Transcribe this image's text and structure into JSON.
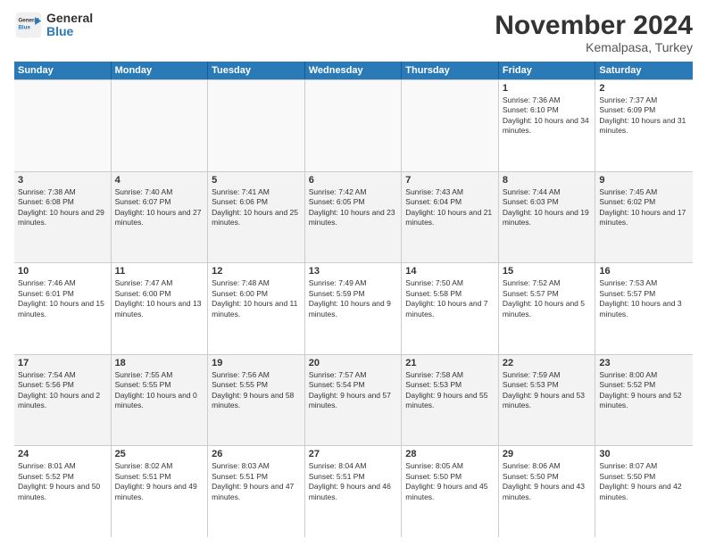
{
  "logo": {
    "general": "General",
    "blue": "Blue"
  },
  "title": "November 2024",
  "location": "Kemalpasa, Turkey",
  "days_header": [
    "Sunday",
    "Monday",
    "Tuesday",
    "Wednesday",
    "Thursday",
    "Friday",
    "Saturday"
  ],
  "rows": [
    [
      {
        "day": "",
        "info": "",
        "empty": true
      },
      {
        "day": "",
        "info": "",
        "empty": true
      },
      {
        "day": "",
        "info": "",
        "empty": true
      },
      {
        "day": "",
        "info": "",
        "empty": true
      },
      {
        "day": "",
        "info": "",
        "empty": true
      },
      {
        "day": "1",
        "info": "Sunrise: 7:36 AM\nSunset: 6:10 PM\nDaylight: 10 hours and 34 minutes."
      },
      {
        "day": "2",
        "info": "Sunrise: 7:37 AM\nSunset: 6:09 PM\nDaylight: 10 hours and 31 minutes."
      }
    ],
    [
      {
        "day": "3",
        "info": "Sunrise: 7:38 AM\nSunset: 6:08 PM\nDaylight: 10 hours and 29 minutes."
      },
      {
        "day": "4",
        "info": "Sunrise: 7:40 AM\nSunset: 6:07 PM\nDaylight: 10 hours and 27 minutes."
      },
      {
        "day": "5",
        "info": "Sunrise: 7:41 AM\nSunset: 6:06 PM\nDaylight: 10 hours and 25 minutes."
      },
      {
        "day": "6",
        "info": "Sunrise: 7:42 AM\nSunset: 6:05 PM\nDaylight: 10 hours and 23 minutes."
      },
      {
        "day": "7",
        "info": "Sunrise: 7:43 AM\nSunset: 6:04 PM\nDaylight: 10 hours and 21 minutes."
      },
      {
        "day": "8",
        "info": "Sunrise: 7:44 AM\nSunset: 6:03 PM\nDaylight: 10 hours and 19 minutes."
      },
      {
        "day": "9",
        "info": "Sunrise: 7:45 AM\nSunset: 6:02 PM\nDaylight: 10 hours and 17 minutes."
      }
    ],
    [
      {
        "day": "10",
        "info": "Sunrise: 7:46 AM\nSunset: 6:01 PM\nDaylight: 10 hours and 15 minutes."
      },
      {
        "day": "11",
        "info": "Sunrise: 7:47 AM\nSunset: 6:00 PM\nDaylight: 10 hours and 13 minutes."
      },
      {
        "day": "12",
        "info": "Sunrise: 7:48 AM\nSunset: 6:00 PM\nDaylight: 10 hours and 11 minutes."
      },
      {
        "day": "13",
        "info": "Sunrise: 7:49 AM\nSunset: 5:59 PM\nDaylight: 10 hours and 9 minutes."
      },
      {
        "day": "14",
        "info": "Sunrise: 7:50 AM\nSunset: 5:58 PM\nDaylight: 10 hours and 7 minutes."
      },
      {
        "day": "15",
        "info": "Sunrise: 7:52 AM\nSunset: 5:57 PM\nDaylight: 10 hours and 5 minutes."
      },
      {
        "day": "16",
        "info": "Sunrise: 7:53 AM\nSunset: 5:57 PM\nDaylight: 10 hours and 3 minutes."
      }
    ],
    [
      {
        "day": "17",
        "info": "Sunrise: 7:54 AM\nSunset: 5:56 PM\nDaylight: 10 hours and 2 minutes."
      },
      {
        "day": "18",
        "info": "Sunrise: 7:55 AM\nSunset: 5:55 PM\nDaylight: 10 hours and 0 minutes."
      },
      {
        "day": "19",
        "info": "Sunrise: 7:56 AM\nSunset: 5:55 PM\nDaylight: 9 hours and 58 minutes."
      },
      {
        "day": "20",
        "info": "Sunrise: 7:57 AM\nSunset: 5:54 PM\nDaylight: 9 hours and 57 minutes."
      },
      {
        "day": "21",
        "info": "Sunrise: 7:58 AM\nSunset: 5:53 PM\nDaylight: 9 hours and 55 minutes."
      },
      {
        "day": "22",
        "info": "Sunrise: 7:59 AM\nSunset: 5:53 PM\nDaylight: 9 hours and 53 minutes."
      },
      {
        "day": "23",
        "info": "Sunrise: 8:00 AM\nSunset: 5:52 PM\nDaylight: 9 hours and 52 minutes."
      }
    ],
    [
      {
        "day": "24",
        "info": "Sunrise: 8:01 AM\nSunset: 5:52 PM\nDaylight: 9 hours and 50 minutes."
      },
      {
        "day": "25",
        "info": "Sunrise: 8:02 AM\nSunset: 5:51 PM\nDaylight: 9 hours and 49 minutes."
      },
      {
        "day": "26",
        "info": "Sunrise: 8:03 AM\nSunset: 5:51 PM\nDaylight: 9 hours and 47 minutes."
      },
      {
        "day": "27",
        "info": "Sunrise: 8:04 AM\nSunset: 5:51 PM\nDaylight: 9 hours and 46 minutes."
      },
      {
        "day": "28",
        "info": "Sunrise: 8:05 AM\nSunset: 5:50 PM\nDaylight: 9 hours and 45 minutes."
      },
      {
        "day": "29",
        "info": "Sunrise: 8:06 AM\nSunset: 5:50 PM\nDaylight: 9 hours and 43 minutes."
      },
      {
        "day": "30",
        "info": "Sunrise: 8:07 AM\nSunset: 5:50 PM\nDaylight: 9 hours and 42 minutes."
      }
    ]
  ]
}
